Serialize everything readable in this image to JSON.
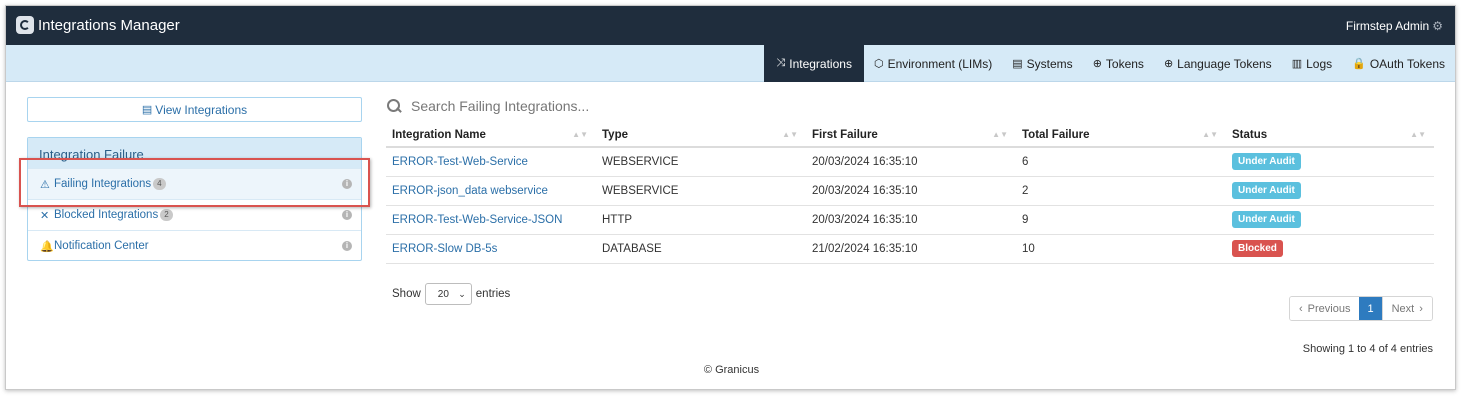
{
  "app": {
    "title": "Integrations Manager",
    "user": "Firmstep Admin"
  },
  "nav": [
    {
      "label": "Integrations",
      "icon": "shuffle-icon",
      "glyph": "⤨",
      "active": true
    },
    {
      "label": "Environment (LIMs)",
      "icon": "cube-icon",
      "glyph": "⬡",
      "active": false
    },
    {
      "label": "Systems",
      "icon": "database-icon",
      "glyph": "▤",
      "active": false
    },
    {
      "label": "Tokens",
      "icon": "globe-icon",
      "glyph": "⊕",
      "active": false
    },
    {
      "label": "Language Tokens",
      "icon": "globe-icon",
      "glyph": "⊕",
      "active": false
    },
    {
      "label": "Logs",
      "icon": "bar-chart-icon",
      "glyph": "▥",
      "active": false
    },
    {
      "label": "OAuth Tokens",
      "icon": "lock-icon",
      "glyph": "🔒",
      "active": false
    }
  ],
  "sidebar": {
    "view_button": "View Integrations",
    "panel_title": "Integration Failure",
    "items": [
      {
        "label": "Failing Integrations",
        "count": "4",
        "icon": "warning-icon",
        "glyph": "⚠"
      },
      {
        "label": "Blocked Integrations",
        "count": "2",
        "icon": "close-icon",
        "glyph": "✕"
      },
      {
        "label": "Notification Center",
        "count": "",
        "icon": "bell-icon",
        "glyph": "🔔"
      }
    ]
  },
  "search": {
    "placeholder": "Search Failing Integrations..."
  },
  "table": {
    "columns": [
      "Integration Name",
      "Type",
      "First Failure",
      "Total Failure",
      "Status"
    ],
    "rows": [
      {
        "name": "ERROR-Test-Web-Service",
        "type": "WEBSERVICE",
        "first_failure": "20/03/2024 16:35:10",
        "total": "6",
        "status": "Under Audit",
        "status_color": "#5bc0de"
      },
      {
        "name": "ERROR-json_data webservice",
        "type": "WEBSERVICE",
        "first_failure": "20/03/2024 16:35:10",
        "total": "2",
        "status": "Under Audit",
        "status_color": "#5bc0de"
      },
      {
        "name": "ERROR-Test-Web-Service-JSON",
        "type": "HTTP",
        "first_failure": "20/03/2024 16:35:10",
        "total": "9",
        "status": "Under Audit",
        "status_color": "#5bc0de"
      },
      {
        "name": "ERROR-Slow DB-5s",
        "type": "DATABASE",
        "first_failure": "21/02/2024 16:35:10",
        "total": "10",
        "status": "Blocked",
        "status_color": "#d9534f"
      }
    ]
  },
  "length": {
    "show": "Show",
    "value": "20",
    "entries": "entries"
  },
  "pagination": {
    "previous": "Previous",
    "current": "1",
    "next": "Next"
  },
  "info": "Showing 1 to 4 of 4 entries",
  "footer": "© Granicus"
}
